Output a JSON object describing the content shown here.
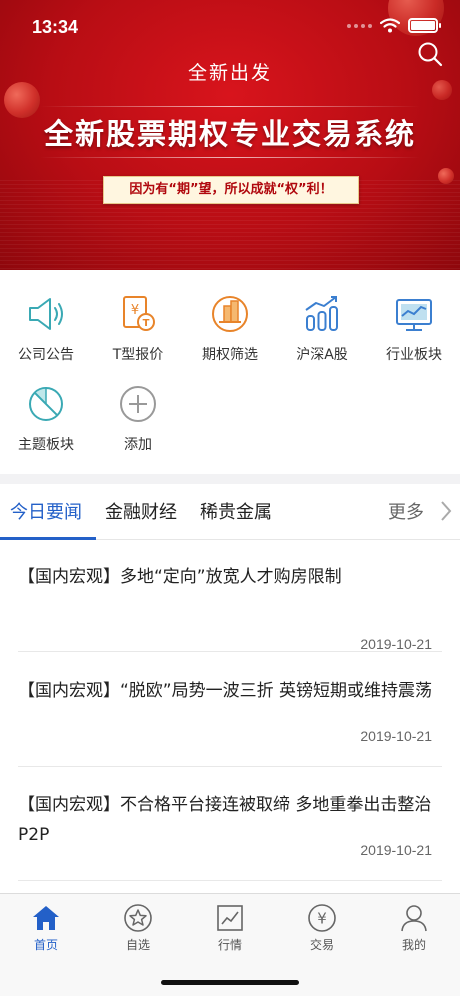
{
  "status": {
    "time": "13:34"
  },
  "banner": {
    "subtitle": "全新出发",
    "title": "全新股票期权专业交易系统",
    "slogan": "因为有“期”望，所以成就“权”利！"
  },
  "quick_items": [
    {
      "label": "公司公告",
      "icon": "speaker-icon"
    },
    {
      "label": "T型报价",
      "icon": "yen-document-icon"
    },
    {
      "label": "期权筛选",
      "icon": "building-filter-icon"
    },
    {
      "label": "沪深A股",
      "icon": "bar-chart-trend-icon"
    },
    {
      "label": "行业板块",
      "icon": "monitor-chart-icon"
    },
    {
      "label": "主题板块",
      "icon": "pie-slash-icon"
    },
    {
      "label": "添加",
      "icon": "add-circle-icon"
    }
  ],
  "news_tabs": {
    "items": [
      "今日要闻",
      "金融财经",
      "稀贵金属"
    ],
    "active": "今日要闻",
    "more": "更多"
  },
  "news": [
    {
      "title": "【国内宏观】多地“定向”放宽人才购房限制",
      "date": "2019-10-21"
    },
    {
      "title": "【国内宏观】“脱欧”局势一波三折 英镑短期或维持震荡",
      "date": "2019-10-21"
    },
    {
      "title": "【国内宏观】不合格平台接连被取缔 多地重拳出击整治P2P",
      "date": "2019-10-21"
    }
  ],
  "tabbar": {
    "active": "首页",
    "items": [
      {
        "label": "首页",
        "icon": "home-icon"
      },
      {
        "label": "自选",
        "icon": "star-circle-icon"
      },
      {
        "label": "行情",
        "icon": "chart-square-icon"
      },
      {
        "label": "交易",
        "icon": "yen-circle-icon"
      },
      {
        "label": "我的",
        "icon": "person-icon"
      }
    ]
  },
  "colors": {
    "accent": "#2360c8",
    "banner_red": "#c8101a",
    "icon_teal": "#3aa9b4",
    "icon_orange": "#e8842a",
    "icon_blue": "#3b7fd0"
  }
}
